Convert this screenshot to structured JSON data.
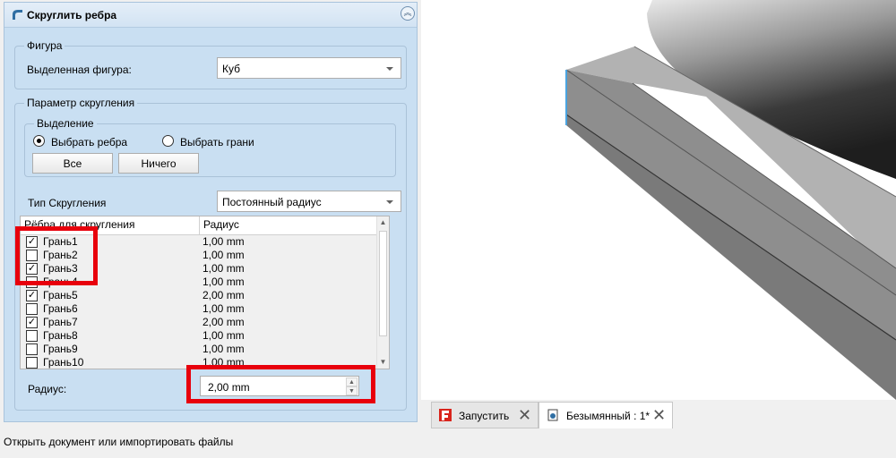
{
  "panel": {
    "title": "Скруглить ребра",
    "shape_group": {
      "title": "Фигура",
      "selected_label": "Выделенная фигура:",
      "selected_value": "Куб"
    },
    "params_group": {
      "title": "Параметр скругления",
      "selection": {
        "title": "Выделение",
        "radio_edges": "Выбрать ребра",
        "radio_faces": "Выбрать грани",
        "radio_edges_selected": true,
        "btn_all": "Все",
        "btn_none": "Ничего"
      },
      "type_label": "Тип Скругления",
      "type_value": "Постоянный радиус",
      "table": {
        "col_name": "Рёбра для скругления",
        "col_radius": "Радиус",
        "rows": [
          {
            "name": "Грань1",
            "radius": "1,00 mm",
            "checked": true
          },
          {
            "name": "Грань2",
            "radius": "1,00 mm",
            "checked": false
          },
          {
            "name": "Грань3",
            "radius": "1,00 mm",
            "checked": true
          },
          {
            "name": "Грань4",
            "radius": "1,00 mm",
            "checked": false
          },
          {
            "name": "Грань5",
            "radius": "2,00 mm",
            "checked": true
          },
          {
            "name": "Грань6",
            "radius": "1,00 mm",
            "checked": false
          },
          {
            "name": "Грань7",
            "radius": "2,00 mm",
            "checked": true
          },
          {
            "name": "Грань8",
            "radius": "1,00 mm",
            "checked": false
          },
          {
            "name": "Грань9",
            "radius": "1,00 mm",
            "checked": false
          },
          {
            "name": "Грань10",
            "radius": "1,00 mm",
            "checked": false
          }
        ]
      },
      "radius_label": "Радиус:",
      "radius_value": "2,00 mm"
    }
  },
  "tabs": [
    {
      "label": "Запустить",
      "active": false
    },
    {
      "label": "Безымянный : 1*",
      "active": true
    }
  ],
  "status_bar": "Открыть документ или импортировать файлы",
  "colors": {
    "panel_bg": "#c9dff2",
    "highlight": "#e8000c"
  }
}
